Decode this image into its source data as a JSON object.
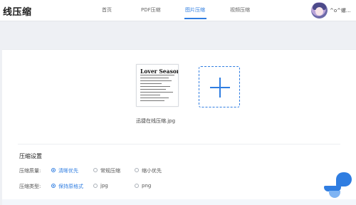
{
  "header": {
    "logo": "线压缩",
    "nav": [
      {
        "label": "首页",
        "active": false
      },
      {
        "label": "PDF压缩",
        "active": false
      },
      {
        "label": "图片压缩",
        "active": true
      },
      {
        "label": "视频压缩",
        "active": false
      }
    ],
    "username": "^o^螺..."
  },
  "upload": {
    "thumbnail_title": "Lover Season",
    "filename": "迅捷在线压缩.jpg",
    "add_icon": "plus-icon"
  },
  "settings": {
    "title": "压缩设置",
    "quality": {
      "label": "压缩质量:",
      "options": [
        "清晰优先",
        "常规压缩",
        "缩小优先"
      ],
      "selected": 0
    },
    "type": {
      "label": "压缩类型:",
      "options": [
        "保持原格式",
        "jpg",
        "png"
      ],
      "selected": 0
    }
  },
  "colors": {
    "accent": "#2f7de1",
    "background": "#eef0f4"
  }
}
